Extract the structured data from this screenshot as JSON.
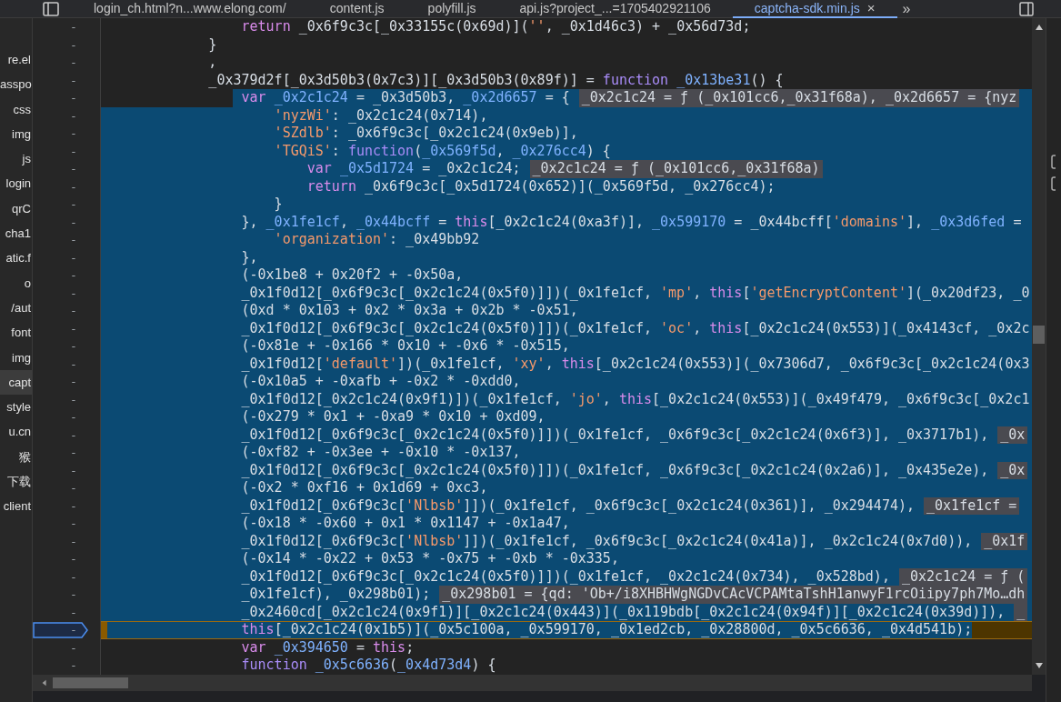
{
  "tabs": [
    {
      "label": "login_ch.html?n...www.elong.com/",
      "selected": false
    },
    {
      "label": "content.js",
      "selected": false
    },
    {
      "label": "polyfill.js",
      "selected": false
    },
    {
      "label": "api.js?project_...=1705402921106",
      "selected": false
    },
    {
      "label": "captcha-sdk.min.js",
      "selected": true,
      "close": "×"
    }
  ],
  "tabs_more": "»",
  "sidebar": {
    "items": [
      {
        "label": "re.el",
        "selected": false
      },
      {
        "label": "asspo",
        "selected": false
      },
      {
        "label": "css",
        "selected": false
      },
      {
        "label": "img",
        "selected": false
      },
      {
        "label": "js",
        "selected": false
      },
      {
        "label": "login",
        "selected": false
      },
      {
        "label": "qrC",
        "selected": false
      },
      {
        "label": "cha1",
        "selected": false
      },
      {
        "label": "atic.f",
        "selected": false
      },
      {
        "label": "o",
        "selected": false
      },
      {
        "label": "/aut",
        "selected": false
      },
      {
        "label": "font",
        "selected": false
      },
      {
        "label": "img",
        "selected": false
      },
      {
        "label": "capt",
        "selected": true
      },
      {
        "label": "style",
        "selected": false
      },
      {
        "label": "u.cn",
        "selected": false
      },
      {
        "label": "猴",
        "selected": false
      },
      {
        "label": "下载",
        "selected": false
      },
      {
        "label": "client",
        "selected": false
      }
    ]
  },
  "editor": {
    "lines": [
      {
        "number": "-",
        "kind": "code",
        "selected": false,
        "paused": false,
        "segments": [
          {
            "text": "                return",
            "kind": "kw"
          },
          {
            "text": " _0x6f9c3c[_0x33155c(0x69d)](",
            "kind": "plain"
          },
          {
            "text": "''",
            "kind": "str"
          },
          {
            "text": ", _0x1d46c3) + _0x56d73d;",
            "kind": "plain"
          }
        ]
      },
      {
        "number": "-",
        "kind": "code",
        "selected": false,
        "paused": false,
        "segments": [
          {
            "text": "            }",
            "kind": "plain"
          }
        ]
      },
      {
        "number": "-",
        "kind": "code",
        "selected": false,
        "paused": false,
        "segments": [
          {
            "text": "            ,",
            "kind": "plain"
          }
        ]
      },
      {
        "number": "-",
        "kind": "code",
        "selected": false,
        "paused": false,
        "segments": [
          {
            "text": "            _0x379d2f[_0x3d50b3(0x7c3)][_0x3d50b3(0x89f)] = ",
            "kind": "plain"
          },
          {
            "text": "function ",
            "kind": "fn"
          },
          {
            "text": "_0x13be31",
            "kind": "def"
          },
          {
            "text": "() {",
            "kind": "plain"
          }
        ]
      },
      {
        "number": "-",
        "kind": "selection_start",
        "selected": true,
        "paused": false,
        "segments": [
          {
            "text": "                var ",
            "kind": "kw"
          },
          {
            "text": "_0x2c1c24",
            "kind": "def"
          },
          {
            "text": " = _0x3d50b3, ",
            "kind": "plain"
          },
          {
            "text": "_0x2d6657",
            "kind": "def"
          },
          {
            "text": " = {",
            "kind": "plain"
          },
          {
            "text": "_0x2c1c24 = ƒ (_0x101cc6,_0x31f68a), _0x2d6657 = {nyz",
            "kind": "inline"
          }
        ]
      },
      {
        "number": "-",
        "kind": "code",
        "selected": true,
        "paused": false,
        "segments": [
          {
            "text": "                    'nyzWi'",
            "kind": "str"
          },
          {
            "text": ": _0x2c1c24(0x714),",
            "kind": "plain"
          }
        ]
      },
      {
        "number": "-",
        "kind": "code",
        "selected": true,
        "paused": false,
        "segments": [
          {
            "text": "                    'SZdlb'",
            "kind": "str"
          },
          {
            "text": ": _0x6f9c3c[_0x2c1c24(0x9eb)],",
            "kind": "plain"
          }
        ]
      },
      {
        "number": "-",
        "kind": "code",
        "selected": true,
        "paused": false,
        "segments": [
          {
            "text": "                    'TGQiS'",
            "kind": "str"
          },
          {
            "text": ": ",
            "kind": "plain"
          },
          {
            "text": "function",
            "kind": "fn"
          },
          {
            "text": "(",
            "kind": "plain"
          },
          {
            "text": "_0x569f5d",
            "kind": "def"
          },
          {
            "text": ", ",
            "kind": "plain"
          },
          {
            "text": "_0x276cc4",
            "kind": "def"
          },
          {
            "text": ") {",
            "kind": "plain"
          }
        ]
      },
      {
        "number": "-",
        "kind": "code",
        "selected": true,
        "paused": false,
        "segments": [
          {
            "text": "                        var ",
            "kind": "kw"
          },
          {
            "text": "_0x5d1724",
            "kind": "def"
          },
          {
            "text": " = _0x2c1c24;",
            "kind": "plain"
          },
          {
            "text": "_0x2c1c24 = ƒ (_0x101cc6,_0x31f68a)",
            "kind": "inline"
          }
        ]
      },
      {
        "number": "-",
        "kind": "code",
        "selected": true,
        "paused": false,
        "segments": [
          {
            "text": "                        return",
            "kind": "kw"
          },
          {
            "text": " _0x6f9c3c[_0x5d1724(0x652)](_0x569f5d, _0x276cc4);",
            "kind": "plain"
          }
        ]
      },
      {
        "number": "-",
        "kind": "code",
        "selected": true,
        "paused": false,
        "segments": [
          {
            "text": "                    }",
            "kind": "plain"
          }
        ]
      },
      {
        "number": "-",
        "kind": "code",
        "selected": true,
        "paused": false,
        "segments": [
          {
            "text": "                }, ",
            "kind": "plain"
          },
          {
            "text": "_0x1fe1cf",
            "kind": "def"
          },
          {
            "text": ", ",
            "kind": "plain"
          },
          {
            "text": "_0x44bcff",
            "kind": "def"
          },
          {
            "text": " = ",
            "kind": "plain"
          },
          {
            "text": "this",
            "kind": "kw"
          },
          {
            "text": "[_0x2c1c24(0xa3f)], ",
            "kind": "plain"
          },
          {
            "text": "_0x599170",
            "kind": "def"
          },
          {
            "text": " = _0x44bcff[",
            "kind": "plain"
          },
          {
            "text": "'domains'",
            "kind": "str"
          },
          {
            "text": "], ",
            "kind": "plain"
          },
          {
            "text": "_0x3d6fed",
            "kind": "def"
          },
          {
            "text": " =",
            "kind": "plain"
          }
        ]
      },
      {
        "number": "-",
        "kind": "code",
        "selected": true,
        "paused": false,
        "segments": [
          {
            "text": "                    'organization'",
            "kind": "str"
          },
          {
            "text": ": _0x49bb92",
            "kind": "plain"
          }
        ]
      },
      {
        "number": "-",
        "kind": "code",
        "selected": true,
        "paused": false,
        "segments": [
          {
            "text": "                },",
            "kind": "plain"
          }
        ]
      },
      {
        "number": "-",
        "kind": "code",
        "selected": true,
        "paused": false,
        "segments": [
          {
            "text": "                (-0x1be8 + 0x20f2 + -0x50a,",
            "kind": "plain"
          }
        ]
      },
      {
        "number": "-",
        "kind": "code",
        "selected": true,
        "paused": false,
        "segments": [
          {
            "text": "                _0x1f0d12[_0x6f9c3c[_0x2c1c24(0x5f0)]])(_0x1fe1cf, ",
            "kind": "plain"
          },
          {
            "text": "'mp'",
            "kind": "str"
          },
          {
            "text": ", ",
            "kind": "plain"
          },
          {
            "text": "this",
            "kind": "kw"
          },
          {
            "text": "[",
            "kind": "plain"
          },
          {
            "text": "'getEncryptContent'",
            "kind": "str"
          },
          {
            "text": "](_0x20df23, _0",
            "kind": "plain"
          }
        ]
      },
      {
        "number": "-",
        "kind": "code",
        "selected": true,
        "paused": false,
        "segments": [
          {
            "text": "                (0xd * 0x103 + 0x2 * 0x3a + 0x2b * -0x51,",
            "kind": "plain"
          }
        ]
      },
      {
        "number": "-",
        "kind": "code",
        "selected": true,
        "paused": false,
        "segments": [
          {
            "text": "                _0x1f0d12[_0x6f9c3c[_0x2c1c24(0x5f0)]])(_0x1fe1cf, ",
            "kind": "plain"
          },
          {
            "text": "'oc'",
            "kind": "str"
          },
          {
            "text": ", ",
            "kind": "plain"
          },
          {
            "text": "this",
            "kind": "kw"
          },
          {
            "text": "[_0x2c1c24(0x553)](_0x4143cf, _0x2c",
            "kind": "plain"
          }
        ]
      },
      {
        "number": "-",
        "kind": "code",
        "selected": true,
        "paused": false,
        "segments": [
          {
            "text": "                (-0x81e + -0x166 * 0x10 + -0x6 * -0x515,",
            "kind": "plain"
          }
        ]
      },
      {
        "number": "-",
        "kind": "code",
        "selected": true,
        "paused": false,
        "segments": [
          {
            "text": "                _0x1f0d12[",
            "kind": "plain"
          },
          {
            "text": "'default'",
            "kind": "str"
          },
          {
            "text": "])(_0x1fe1cf, ",
            "kind": "plain"
          },
          {
            "text": "'xy'",
            "kind": "str"
          },
          {
            "text": ", ",
            "kind": "plain"
          },
          {
            "text": "this",
            "kind": "kw"
          },
          {
            "text": "[_0x2c1c24(0x553)](_0x7306d7, _0x6f9c3c[_0x2c1c24(0x3",
            "kind": "plain"
          }
        ]
      },
      {
        "number": "-",
        "kind": "code",
        "selected": true,
        "paused": false,
        "segments": [
          {
            "text": "                (-0x10a5 + -0xafb + -0x2 * -0xdd0,",
            "kind": "plain"
          }
        ]
      },
      {
        "number": "-",
        "kind": "code",
        "selected": true,
        "paused": false,
        "segments": [
          {
            "text": "                _0x1f0d12[_0x2c1c24(0x9f1)])(_0x1fe1cf, ",
            "kind": "plain"
          },
          {
            "text": "'jo'",
            "kind": "str"
          },
          {
            "text": ", ",
            "kind": "plain"
          },
          {
            "text": "this",
            "kind": "kw"
          },
          {
            "text": "[_0x2c1c24(0x553)](_0x49f479, _0x6f9c3c[_0x2c1",
            "kind": "plain"
          }
        ]
      },
      {
        "number": "-",
        "kind": "code",
        "selected": true,
        "paused": false,
        "segments": [
          {
            "text": "                (-0x279 * 0x1 + -0xa9 * 0x10 + 0xd09,",
            "kind": "plain"
          }
        ]
      },
      {
        "number": "-",
        "kind": "code",
        "selected": true,
        "paused": false,
        "segments": [
          {
            "text": "                _0x1f0d12[_0x6f9c3c[_0x2c1c24(0x5f0)]])(_0x1fe1cf, _0x6f9c3c[_0x2c1c24(0x6f3)], _0x3717b1),",
            "kind": "plain"
          },
          {
            "text": "_0x",
            "kind": "inline"
          }
        ]
      },
      {
        "number": "-",
        "kind": "code",
        "selected": true,
        "paused": false,
        "segments": [
          {
            "text": "                (-0xf82 + -0x3ee + -0x10 * -0x137,",
            "kind": "plain"
          }
        ]
      },
      {
        "number": "-",
        "kind": "code",
        "selected": true,
        "paused": false,
        "segments": [
          {
            "text": "                _0x1f0d12[_0x6f9c3c[_0x2c1c24(0x5f0)]])(_0x1fe1cf, _0x6f9c3c[_0x2c1c24(0x2a6)], _0x435e2e),",
            "kind": "plain"
          },
          {
            "text": "_0x",
            "kind": "inline"
          }
        ]
      },
      {
        "number": "-",
        "kind": "code",
        "selected": true,
        "paused": false,
        "segments": [
          {
            "text": "                (-0x2 * 0xf16 + 0x1d69 + 0xc3,",
            "kind": "plain"
          }
        ]
      },
      {
        "number": "-",
        "kind": "code",
        "selected": true,
        "paused": false,
        "segments": [
          {
            "text": "                _0x1f0d12[_0x6f9c3c[",
            "kind": "plain"
          },
          {
            "text": "'Nlbsb'",
            "kind": "str"
          },
          {
            "text": "]])(_0x1fe1cf, _0x6f9c3c[_0x2c1c24(0x361)], _0x294474),",
            "kind": "plain"
          },
          {
            "text": "_0x1fe1cf =",
            "kind": "inline"
          }
        ]
      },
      {
        "number": "-",
        "kind": "code",
        "selected": true,
        "paused": false,
        "segments": [
          {
            "text": "                (-0x18 * -0x60 + 0x1 * 0x1147 + -0x1a47,",
            "kind": "plain"
          }
        ]
      },
      {
        "number": "-",
        "kind": "code",
        "selected": true,
        "paused": false,
        "segments": [
          {
            "text": "                _0x1f0d12[_0x6f9c3c[",
            "kind": "plain"
          },
          {
            "text": "'Nlbsb'",
            "kind": "str"
          },
          {
            "text": "]])(_0x1fe1cf, _0x6f9c3c[_0x2c1c24(0x41a)], _0x2c1c24(0x7d0)),",
            "kind": "plain"
          },
          {
            "text": "_0x1f",
            "kind": "inline"
          }
        ]
      },
      {
        "number": "-",
        "kind": "code",
        "selected": true,
        "paused": false,
        "segments": [
          {
            "text": "                (-0x14 * -0x22 + 0x53 * -0x75 + -0xb * -0x335,",
            "kind": "plain"
          }
        ]
      },
      {
        "number": "-",
        "kind": "code",
        "selected": true,
        "paused": false,
        "segments": [
          {
            "text": "                _0x1f0d12[_0x6f9c3c[_0x2c1c24(0x5f0)]])(_0x1fe1cf, _0x2c1c24(0x734), _0x528bd),",
            "kind": "plain"
          },
          {
            "text": "_0x2c1c24 = ƒ (",
            "kind": "inline"
          }
        ]
      },
      {
        "number": "-",
        "kind": "code",
        "selected": true,
        "paused": false,
        "segments": [
          {
            "text": "                _0x1fe1cf), _0x298b01);",
            "kind": "plain"
          },
          {
            "text": "_0x298b01 = {qd: 'Ob+/i8XHBHWgNGDvCAcVCPAMtaTshH1anwyF1rcOiipy7ph7Mo…dh",
            "kind": "inline"
          }
        ]
      },
      {
        "number": "-",
        "kind": "code",
        "selected": true,
        "paused": false,
        "segments": [
          {
            "text": "                _0x2460cd[_0x2c1c24(0x9f1)][_0x2c1c24(0x443)](_0x119bdb[_0x2c1c24(0x94f)][_0x2c1c24(0x39d)]),",
            "kind": "plain"
          },
          {
            "text": "_",
            "kind": "inline"
          }
        ]
      },
      {
        "number": "-",
        "kind": "code",
        "selected": true,
        "paused": true,
        "segments": [
          {
            "text": "                this",
            "kind": "kw"
          },
          {
            "text": "[_0x2c1c24(0x1b5)](_0x5c100a, _0x599170, _0x1ed2cb, _0x28800d, _0x5c6636, _0x4d541b);",
            "kind": "plain"
          }
        ]
      },
      {
        "number": "-",
        "kind": "code",
        "selected": false,
        "paused": false,
        "segments": [
          {
            "text": "                var ",
            "kind": "kw"
          },
          {
            "text": "_0x394650",
            "kind": "def"
          },
          {
            "text": " = ",
            "kind": "plain"
          },
          {
            "text": "this",
            "kind": "kw"
          },
          {
            "text": ";",
            "kind": "plain"
          }
        ]
      },
      {
        "number": "-",
        "kind": "code",
        "selected": false,
        "paused": false,
        "segments": [
          {
            "text": "                function ",
            "kind": "fn"
          },
          {
            "text": "_0x5c6636",
            "kind": "def"
          },
          {
            "text": "(",
            "kind": "plain"
          },
          {
            "text": "_0x4d73d4",
            "kind": "def"
          },
          {
            "text": ") {",
            "kind": "plain"
          }
        ]
      }
    ]
  }
}
